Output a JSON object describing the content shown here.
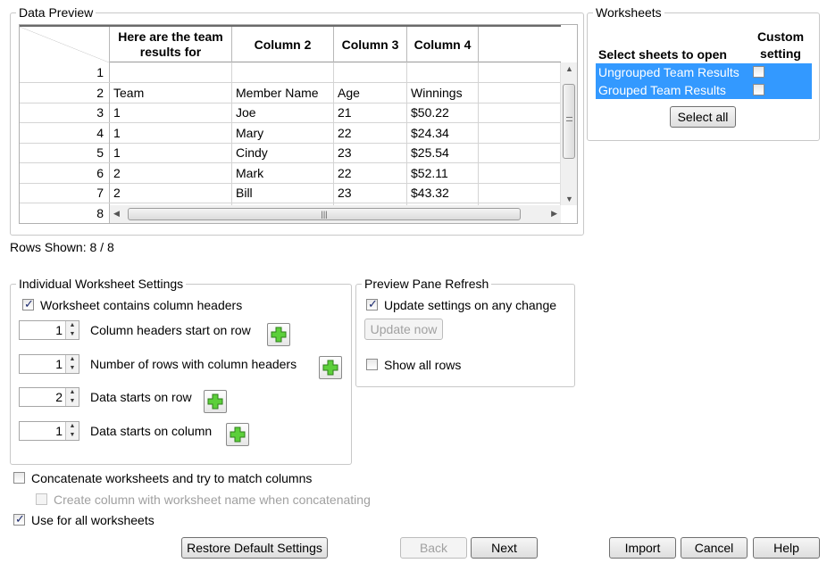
{
  "data_preview": {
    "title": "Data Preview",
    "columns": [
      "Here are the team results for",
      "Column 2",
      "Column 3",
      "Column 4"
    ],
    "rows": [
      {
        "num": "1",
        "cells": [
          "",
          "",
          "",
          ""
        ]
      },
      {
        "num": "2",
        "cells": [
          "Team",
          "Member Name",
          "Age",
          "Winnings"
        ]
      },
      {
        "num": "3",
        "cells": [
          "1",
          "Joe",
          "21",
          "$50.22"
        ]
      },
      {
        "num": "4",
        "cells": [
          "1",
          "Mary",
          "22",
          "$24.34"
        ]
      },
      {
        "num": "5",
        "cells": [
          "1",
          "Cindy",
          "23",
          "$25.54"
        ]
      },
      {
        "num": "6",
        "cells": [
          "2",
          "Mark",
          "22",
          "$52.11"
        ]
      },
      {
        "num": "7",
        "cells": [
          "2",
          "Bill",
          "23",
          "$43.32"
        ]
      },
      {
        "num": "8",
        "cells": [
          "",
          "",
          "",
          ""
        ]
      }
    ],
    "rows_shown": "Rows Shown: 8 / 8"
  },
  "worksheets": {
    "title": "Worksheets",
    "col_select": "Select sheets to open",
    "col_custom": "Custom setting",
    "sheets": [
      {
        "name": "Ungrouped Team Results",
        "custom": false
      },
      {
        "name": "Grouped Team Results",
        "custom": false
      }
    ],
    "select_all": "Select all"
  },
  "individual": {
    "title": "Individual Worksheet Settings",
    "contains_headers": {
      "label": "Worksheet contains column headers",
      "checked": true
    },
    "spinners": [
      {
        "value": "1",
        "label": "Column headers start on row"
      },
      {
        "value": "1",
        "label": "Number of rows with column headers"
      },
      {
        "value": "2",
        "label": "Data starts on row"
      },
      {
        "value": "1",
        "label": "Data starts on column"
      }
    ]
  },
  "preview_refresh": {
    "title": "Preview Pane Refresh",
    "update_any": {
      "label": "Update settings on any change",
      "checked": true
    },
    "update_now": "Update now",
    "show_all": {
      "label": "Show all rows",
      "checked": false
    }
  },
  "options": {
    "concatenate": {
      "label": "Concatenate worksheets and try to match columns",
      "checked": false
    },
    "create_column": {
      "label": "Create column with worksheet name when concatenating",
      "checked": false
    },
    "use_all": {
      "label": "Use for all worksheets",
      "checked": true
    }
  },
  "buttons": {
    "restore": "Restore Default Settings",
    "back": "Back",
    "next": "Next",
    "import": "Import",
    "cancel": "Cancel",
    "help": "Help"
  }
}
